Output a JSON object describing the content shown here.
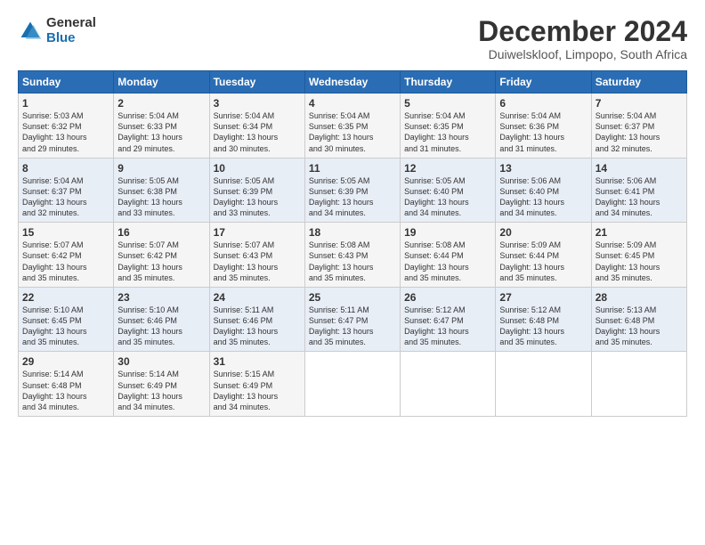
{
  "logo": {
    "general": "General",
    "blue": "Blue"
  },
  "title": "December 2024",
  "subtitle": "Duiwelskloof, Limpopo, South Africa",
  "days_of_week": [
    "Sunday",
    "Monday",
    "Tuesday",
    "Wednesday",
    "Thursday",
    "Friday",
    "Saturday"
  ],
  "weeks": [
    [
      {
        "date": "1",
        "sunrise": "5:03 AM",
        "sunset": "6:32 PM",
        "daylight": "13 hours and 29 minutes."
      },
      {
        "date": "2",
        "sunrise": "5:04 AM",
        "sunset": "6:33 PM",
        "daylight": "13 hours and 29 minutes."
      },
      {
        "date": "3",
        "sunrise": "5:04 AM",
        "sunset": "6:34 PM",
        "daylight": "13 hours and 30 minutes."
      },
      {
        "date": "4",
        "sunrise": "5:04 AM",
        "sunset": "6:35 PM",
        "daylight": "13 hours and 30 minutes."
      },
      {
        "date": "5",
        "sunrise": "5:04 AM",
        "sunset": "6:35 PM",
        "daylight": "13 hours and 31 minutes."
      },
      {
        "date": "6",
        "sunrise": "5:04 AM",
        "sunset": "6:36 PM",
        "daylight": "13 hours and 31 minutes."
      },
      {
        "date": "7",
        "sunrise": "5:04 AM",
        "sunset": "6:37 PM",
        "daylight": "13 hours and 32 minutes."
      }
    ],
    [
      {
        "date": "8",
        "sunrise": "5:04 AM",
        "sunset": "6:37 PM",
        "daylight": "13 hours and 32 minutes."
      },
      {
        "date": "9",
        "sunrise": "5:05 AM",
        "sunset": "6:38 PM",
        "daylight": "13 hours and 33 minutes."
      },
      {
        "date": "10",
        "sunrise": "5:05 AM",
        "sunset": "6:39 PM",
        "daylight": "13 hours and 33 minutes."
      },
      {
        "date": "11",
        "sunrise": "5:05 AM",
        "sunset": "6:39 PM",
        "daylight": "13 hours and 34 minutes."
      },
      {
        "date": "12",
        "sunrise": "5:05 AM",
        "sunset": "6:40 PM",
        "daylight": "13 hours and 34 minutes."
      },
      {
        "date": "13",
        "sunrise": "5:06 AM",
        "sunset": "6:40 PM",
        "daylight": "13 hours and 34 minutes."
      },
      {
        "date": "14",
        "sunrise": "5:06 AM",
        "sunset": "6:41 PM",
        "daylight": "13 hours and 34 minutes."
      }
    ],
    [
      {
        "date": "15",
        "sunrise": "5:07 AM",
        "sunset": "6:42 PM",
        "daylight": "13 hours and 35 minutes."
      },
      {
        "date": "16",
        "sunrise": "5:07 AM",
        "sunset": "6:42 PM",
        "daylight": "13 hours and 35 minutes."
      },
      {
        "date": "17",
        "sunrise": "5:07 AM",
        "sunset": "6:43 PM",
        "daylight": "13 hours and 35 minutes."
      },
      {
        "date": "18",
        "sunrise": "5:08 AM",
        "sunset": "6:43 PM",
        "daylight": "13 hours and 35 minutes."
      },
      {
        "date": "19",
        "sunrise": "5:08 AM",
        "sunset": "6:44 PM",
        "daylight": "13 hours and 35 minutes."
      },
      {
        "date": "20",
        "sunrise": "5:09 AM",
        "sunset": "6:44 PM",
        "daylight": "13 hours and 35 minutes."
      },
      {
        "date": "21",
        "sunrise": "5:09 AM",
        "sunset": "6:45 PM",
        "daylight": "13 hours and 35 minutes."
      }
    ],
    [
      {
        "date": "22",
        "sunrise": "5:10 AM",
        "sunset": "6:45 PM",
        "daylight": "13 hours and 35 minutes."
      },
      {
        "date": "23",
        "sunrise": "5:10 AM",
        "sunset": "6:46 PM",
        "daylight": "13 hours and 35 minutes."
      },
      {
        "date": "24",
        "sunrise": "5:11 AM",
        "sunset": "6:46 PM",
        "daylight": "13 hours and 35 minutes."
      },
      {
        "date": "25",
        "sunrise": "5:11 AM",
        "sunset": "6:47 PM",
        "daylight": "13 hours and 35 minutes."
      },
      {
        "date": "26",
        "sunrise": "5:12 AM",
        "sunset": "6:47 PM",
        "daylight": "13 hours and 35 minutes."
      },
      {
        "date": "27",
        "sunrise": "5:12 AM",
        "sunset": "6:48 PM",
        "daylight": "13 hours and 35 minutes."
      },
      {
        "date": "28",
        "sunrise": "5:13 AM",
        "sunset": "6:48 PM",
        "daylight": "13 hours and 35 minutes."
      }
    ],
    [
      {
        "date": "29",
        "sunrise": "5:14 AM",
        "sunset": "6:48 PM",
        "daylight": "13 hours and 34 minutes."
      },
      {
        "date": "30",
        "sunrise": "5:14 AM",
        "sunset": "6:49 PM",
        "daylight": "13 hours and 34 minutes."
      },
      {
        "date": "31",
        "sunrise": "5:15 AM",
        "sunset": "6:49 PM",
        "daylight": "13 hours and 34 minutes."
      },
      null,
      null,
      null,
      null
    ]
  ],
  "labels": {
    "sunrise": "Sunrise:",
    "sunset": "Sunset:",
    "daylight": "Daylight:"
  },
  "accent_color": "#2a6db5"
}
